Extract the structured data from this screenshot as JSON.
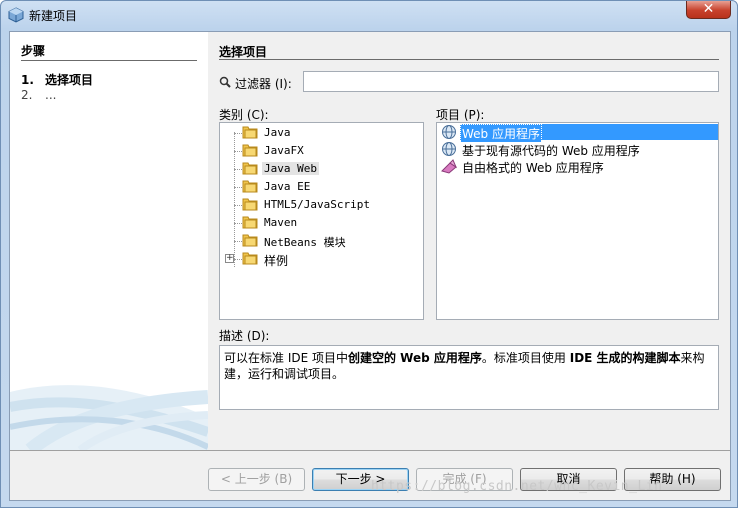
{
  "window": {
    "title": "新建项目",
    "close_label": "✕"
  },
  "steps": {
    "title": "步骤",
    "items": [
      {
        "num": "1.",
        "label": "选择项目"
      },
      {
        "num": "2.",
        "label": "..."
      }
    ]
  },
  "page": {
    "title": "选择项目",
    "filter_label": "过滤器 (I):",
    "filter_value": "",
    "categories_label": "类别 (C):",
    "projects_label": "项目 (P):",
    "description_label": "描述 (D):"
  },
  "categories": [
    {
      "label": "Java"
    },
    {
      "label": "JavaFX"
    },
    {
      "label": "Java Web",
      "selected": true
    },
    {
      "label": "Java EE"
    },
    {
      "label": "HTML5/JavaScript"
    },
    {
      "label": "Maven"
    },
    {
      "label": "NetBeans 模块"
    },
    {
      "label": "样例"
    }
  ],
  "projects": [
    {
      "label": "Web 应用程序",
      "icon": "globe-icon",
      "selected": true
    },
    {
      "label": "基于现有源代码的 Web 应用程序",
      "icon": "globe-icon"
    },
    {
      "label": "自由格式的 Web 应用程序",
      "icon": "freeform-icon"
    }
  ],
  "description": {
    "p1": "可以在标准 IDE 项目中",
    "b1": "创建空的 Web 应用程序",
    "p2": "。标准项目使用 ",
    "b2": "IDE 生成的构建脚本",
    "p3": "来构建，运行和调试项目。"
  },
  "buttons": {
    "back": "< 上一步 (B)",
    "next": "下一步 >",
    "finish": "完成 (F)",
    "cancel": "取消",
    "help": "帮助 (H)"
  },
  "watermark": "https://blog.csdn.net/whc_Kevin_Lin"
}
